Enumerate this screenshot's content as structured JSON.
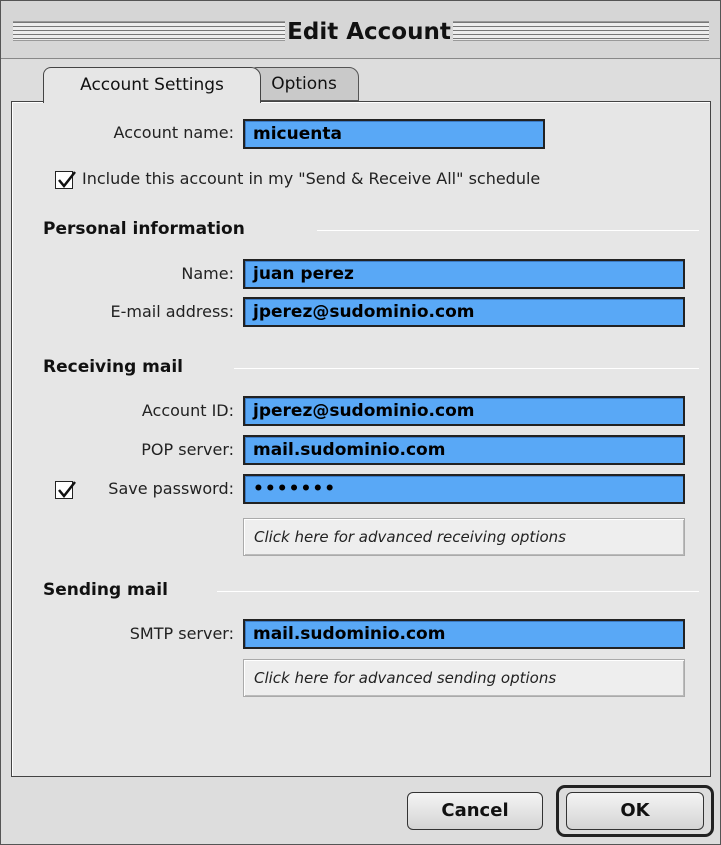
{
  "window": {
    "title": "Edit Account"
  },
  "tabs": [
    {
      "label": "Account Settings",
      "active": true
    },
    {
      "label": "Options",
      "active": false
    }
  ],
  "account": {
    "name_label": "Account name:",
    "name_value": "micuenta",
    "include_checkbox_label": "Include this account in my \"Send & Receive All\" schedule",
    "include_checked": true
  },
  "personal": {
    "heading": "Personal information",
    "name_label": "Name:",
    "name_value": "juan perez",
    "email_label": "E-mail address:",
    "email_value": "jperez@sudominio.com"
  },
  "receiving": {
    "heading": "Receiving mail",
    "account_id_label": "Account ID:",
    "account_id_value": "jperez@sudominio.com",
    "pop_label": "POP server:",
    "pop_value": "mail.sudominio.com",
    "save_password_label": "Save password:",
    "save_password_checked": true,
    "password_value": "•••••••",
    "advanced_label": "Click here for advanced receiving options"
  },
  "sending": {
    "heading": "Sending mail",
    "smtp_label": "SMTP server:",
    "smtp_value": "mail.sudominio.com",
    "advanced_label": "Click here for advanced sending options"
  },
  "buttons": {
    "cancel_label": "Cancel",
    "ok_label": "OK"
  },
  "colors": {
    "field_highlight": "#59a8f6",
    "window_bg": "#e6e6e6"
  }
}
